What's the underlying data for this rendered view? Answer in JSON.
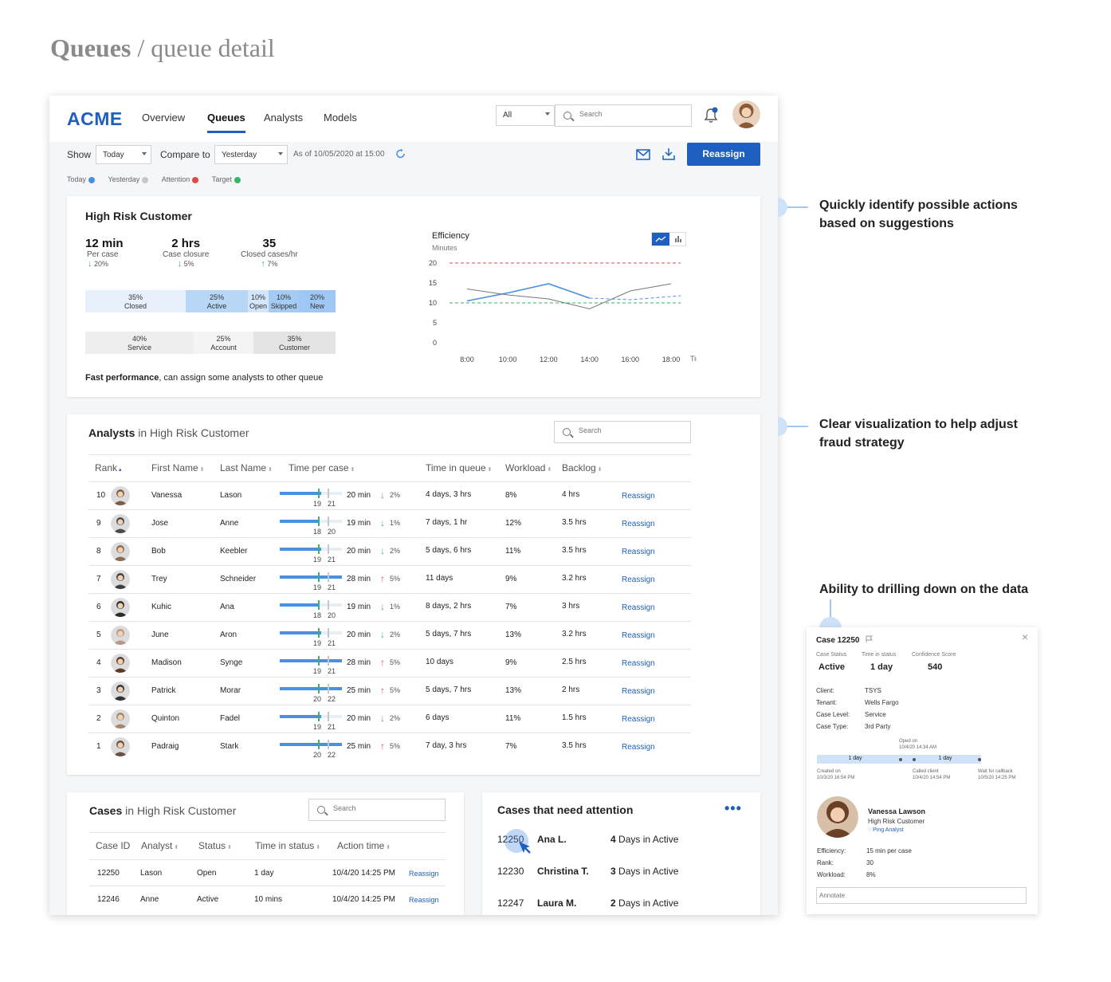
{
  "page_title": {
    "bold": "Queues",
    "rest": " / queue detail"
  },
  "app": {
    "logo": "ACME",
    "nav": [
      "Overview",
      "Queues",
      "Analysts",
      "Models"
    ],
    "active_nav": "Queues",
    "filter_select": "All",
    "search_placeholder": "Search",
    "show_label": "Show",
    "show_value": "Today",
    "compare_label": "Compare to",
    "compare_value": "Yesterday",
    "as_of": "As of 10/05/2020 at 15:00",
    "reassign_button": "Reassign",
    "legend": [
      {
        "label": "Today",
        "color": "#4a90e2"
      },
      {
        "label": "Yesterday",
        "color": "#c4c7cc"
      },
      {
        "label": "Attention",
        "color": "#e04848"
      },
      {
        "label": "Target",
        "color": "#3ab26e"
      }
    ]
  },
  "summary": {
    "title": "High Risk Customer",
    "metrics": [
      {
        "value": "12 min",
        "label": "Per case",
        "change": "20%",
        "dir": "down"
      },
      {
        "value": "2 hrs",
        "label": "Case closure",
        "change": "5%",
        "dir": "down"
      },
      {
        "value": "35",
        "label": "Closed cases/hr",
        "change": "7%",
        "dir": "up"
      }
    ],
    "status_bar": [
      {
        "pct": "35%",
        "label": "Closed",
        "color": "#e8f1fb"
      },
      {
        "pct": "25%",
        "label": "Active",
        "color": "#b8d6f6"
      },
      {
        "pct": "10%",
        "label": "Open",
        "color": "#d3e6fa"
      },
      {
        "pct": "10%",
        "label": "Skipped",
        "color": "#a4cbf3"
      },
      {
        "pct": "20%",
        "label": "New",
        "color": "#9ec8f3"
      }
    ],
    "level_bar": [
      {
        "pct": "40%",
        "label": "Service",
        "color": "#eeeeee"
      },
      {
        "pct": "25%",
        "label": "Account",
        "color": "#f4f4f4"
      },
      {
        "pct": "35%",
        "label": "Customer",
        "color": "#e4e4e4"
      }
    ],
    "insight_bold": "Fast performance",
    "insight_rest": ", can assign some analysts to other queue"
  },
  "chart_data": {
    "type": "line",
    "title": "Efficiency",
    "subtitle": "Minutes",
    "xlabel": "Time",
    "x": [
      "8:00",
      "10:00",
      "12:00",
      "14:00",
      "16:00",
      "18:00"
    ],
    "ylim": [
      0,
      20
    ],
    "yticks": [
      0,
      5,
      10,
      15,
      20
    ],
    "series": [
      {
        "name": "Today",
        "color": "#4a90e2",
        "values": [
          10.5,
          12.5,
          14.8,
          11.2,
          10.8,
          12.2
        ]
      },
      {
        "name": "Yesterday",
        "color": "#777777",
        "values": [
          13.5,
          12,
          11,
          8.5,
          13,
          14.8
        ]
      },
      {
        "name": "Attention",
        "color": "#e04848",
        "dashed": true,
        "values": [
          20,
          20,
          20,
          20,
          20,
          20
        ]
      },
      {
        "name": "Target",
        "color": "#3ab26e",
        "dashed": true,
        "values": [
          10,
          10,
          10,
          10,
          10,
          10
        ]
      }
    ],
    "projection": {
      "color": "#4a90e2",
      "values": [
        10.8,
        11.8
      ]
    }
  },
  "analysts": {
    "title_bold": "Analysts",
    "title_rest": " in High Risk Customer",
    "search_placeholder": "Search",
    "columns": [
      "Rank",
      "First Name",
      "Last Name",
      "Time per case",
      "Time in queue",
      "Workload",
      "Backlog"
    ],
    "rows": [
      {
        "rank": "10",
        "first": "Vanessa",
        "last": "Lason",
        "bar_a": "19",
        "bar_b": "21",
        "fill": 0.67,
        "time": "20 min",
        "chg": "2%",
        "dir": "down",
        "queue": "4 days, 3 hrs",
        "workload": "8%",
        "backlog": "4 hrs",
        "action": "Reassign"
      },
      {
        "rank": "9",
        "first": "Jose",
        "last": "Anne",
        "bar_a": "18",
        "bar_b": "20",
        "fill": 0.62,
        "time": "19 min",
        "chg": "1%",
        "dir": "down",
        "queue": "7 days, 1 hr",
        "workload": "12%",
        "backlog": "3.5 hrs",
        "action": "Reassign"
      },
      {
        "rank": "8",
        "first": "Bob",
        "last": "Keebler",
        "bar_a": "19",
        "bar_b": "21",
        "fill": 0.67,
        "time": "20 min",
        "chg": "2%",
        "dir": "down",
        "queue": "5 days, 6 hrs",
        "workload": "11%",
        "backlog": "3.5 hrs",
        "action": "Reassign"
      },
      {
        "rank": "7",
        "first": "Trey",
        "last": "Schneider",
        "bar_a": "19",
        "bar_b": "21",
        "fill": 1.0,
        "time": "28 min",
        "chg": "5%",
        "dir": "up",
        "queue": "11 days",
        "workload": "9%",
        "backlog": "3.2 hrs",
        "action": "Reassign"
      },
      {
        "rank": "6",
        "first": "Kuhic",
        "last": "Ana",
        "bar_a": "18",
        "bar_b": "20",
        "fill": 0.62,
        "time": "19 min",
        "chg": "1%",
        "dir": "down",
        "queue": "8 days, 2 hrs",
        "workload": "7%",
        "backlog": "3 hrs",
        "action": "Reassign"
      },
      {
        "rank": "5",
        "first": "June",
        "last": "Aron",
        "bar_a": "19",
        "bar_b": "21",
        "fill": 0.67,
        "time": "20 min",
        "chg": "2%",
        "dir": "down",
        "queue": "5 days, 7 hrs",
        "workload": "13%",
        "backlog": "3.2 hrs",
        "action": "Reassign"
      },
      {
        "rank": "4",
        "first": "Madison",
        "last": "Synge",
        "bar_a": "19",
        "bar_b": "21",
        "fill": 1.0,
        "time": "28 min",
        "chg": "5%",
        "dir": "up",
        "queue": "10 days",
        "workload": "9%",
        "backlog": "2.5 hrs",
        "action": "Reassign"
      },
      {
        "rank": "3",
        "first": "Patrick",
        "last": "Morar",
        "bar_a": "20",
        "bar_b": "22",
        "fill": 1.0,
        "time": "25 min",
        "chg": "5%",
        "dir": "up",
        "queue": "5 days, 7 hrs",
        "workload": "13%",
        "backlog": "2 hrs",
        "action": "Reassign"
      },
      {
        "rank": "2",
        "first": "Quinton",
        "last": "Fadel",
        "bar_a": "19",
        "bar_b": "21",
        "fill": 0.67,
        "time": "20 min",
        "chg": "2%",
        "dir": "down",
        "queue": "6 days",
        "workload": "11%",
        "backlog": "1.5 hrs",
        "action": "Reassign"
      },
      {
        "rank": "1",
        "first": "Padraig",
        "last": "Stark",
        "bar_a": "20",
        "bar_b": "22",
        "fill": 1.0,
        "time": "25 min",
        "chg": "5%",
        "dir": "up",
        "queue": "7 day, 3 hrs",
        "workload": "7%",
        "backlog": "3.5 hrs",
        "action": "Reassign"
      }
    ]
  },
  "cases": {
    "title_bold": "Cases",
    "title_rest": " in High Risk Customer",
    "search_placeholder": "Search",
    "columns": [
      "Case ID",
      "Analyst",
      "Status",
      "Time in status",
      "Action time"
    ],
    "rows": [
      {
        "id": "12250",
        "analyst": "Lason",
        "status": "Open",
        "time": "1 day",
        "action_time": "10/4/20 14:25 PM",
        "action": "Reassign"
      },
      {
        "id": "12246",
        "analyst": "Anne",
        "status": "Active",
        "time": "10 mins",
        "action_time": "10/4/20 14:25 PM",
        "action": "Reassign"
      }
    ]
  },
  "attention": {
    "title": "Cases that need attention",
    "rows": [
      {
        "id": "12250",
        "name": "Ana L.",
        "days": "4",
        "rest": " Days in Active"
      },
      {
        "id": "12230",
        "name": "Christina T.",
        "days": "3",
        "rest": " Days in Active"
      },
      {
        "id": "12247",
        "name": "Laura M.",
        "days": "2",
        "rest": " Days in Active"
      }
    ]
  },
  "annotations": [
    {
      "line1": "Quickly identify possible actions",
      "line2": "based on suggestions"
    },
    {
      "line1": "Clear visualization to help adjust",
      "line2": "fraud strategy"
    },
    {
      "line1": "Ability to drilling down on the data",
      "line2": ""
    }
  ],
  "detail": {
    "title": "Case 12250",
    "stat_labels": [
      "Case Status",
      "Time in status",
      "Confidence Score"
    ],
    "stat_values": [
      "Active",
      "1 day",
      "540"
    ],
    "fields": [
      {
        "k": "Client:",
        "v": "TSYS"
      },
      {
        "k": "Tenant:",
        "v": "Wells Fargo"
      },
      {
        "k": "Case Level:",
        "v": "Service"
      },
      {
        "k": "Case Type:",
        "v": "3rd Party"
      }
    ],
    "timeline": {
      "opened_label": "Oped on",
      "opened_date": "10/4/20 14:34 AM",
      "seg1": "1 day",
      "seg2": "1 day",
      "created_label": "Created on",
      "created_date": "10/3/20 16:54 PM",
      "called_label": "Called client",
      "called_date": "10/4/20 14:54 PM",
      "wait_label": "Wait for callback",
      "wait_date": "10/5/20 14:25 PM"
    },
    "analyst_name": "Vanessa Lawson",
    "analyst_queue": "High Risk Customer",
    "ping": "Ping Analyst",
    "stats": [
      {
        "k": "Efficiency:",
        "v": "15 min per case"
      },
      {
        "k": "Rank:",
        "v": "30"
      },
      {
        "k": "Workload:",
        "v": "8%"
      }
    ],
    "annotate_placeholder": "Annotate"
  }
}
